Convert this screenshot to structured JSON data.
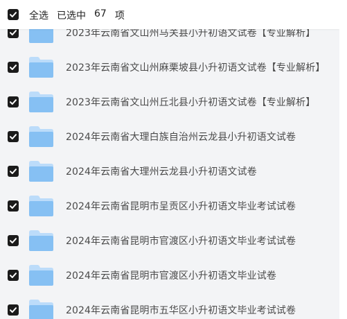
{
  "header": {
    "select_all_label": "全选",
    "selected_prefix": "已选中",
    "selected_count": "67",
    "selected_unit": "项"
  },
  "files": [
    {
      "name": "2023年云南省文山州马关县小升初语文试卷【专业解析】",
      "checked": true
    },
    {
      "name": "2023年云南省文山州麻栗坡县小升初语文试卷【专业解析】",
      "checked": true
    },
    {
      "name": "2023年云南省文山州丘北县小升初语文试卷【专业解析】",
      "checked": true
    },
    {
      "name": "2024年云南省大理白族自治州云龙县小升初语文试卷",
      "checked": true
    },
    {
      "name": "2024年云南省大理州云龙县小升初语文试卷",
      "checked": true
    },
    {
      "name": "2024年云南省昆明市呈贡区小升初语文毕业考试试卷",
      "checked": true
    },
    {
      "name": "2024年云南省昆明市官渡区小升初语文毕业考试试卷",
      "checked": true
    },
    {
      "name": "2024年云南省昆明市官渡区小升初语文毕业试卷",
      "checked": true
    },
    {
      "name": "2024年云南省昆明市五华区小升初语文毕业考试试卷",
      "checked": true
    }
  ],
  "icons": {
    "checkbox": "checkbox-checked-icon",
    "folder": "folder-icon"
  },
  "colors": {
    "checkbox_fill": "#1b1b1b",
    "folder_light": "#bcdcfa",
    "folder_body": "#86c0f3",
    "text": "#4a4a4a"
  }
}
